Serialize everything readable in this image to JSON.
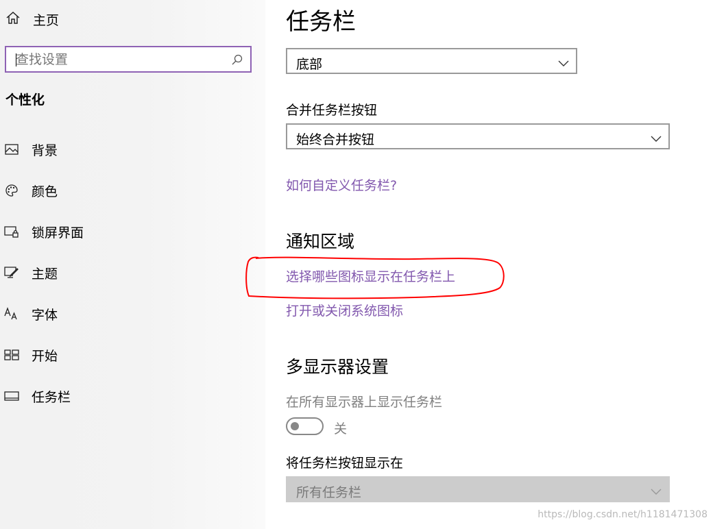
{
  "sidebar": {
    "home": {
      "label": "主页",
      "icon": "home-icon"
    },
    "search": {
      "placeholder": "查找设置",
      "icon": "search-icon"
    },
    "section_title": "个性化",
    "items": [
      {
        "label": "背景",
        "icon": "image-icon"
      },
      {
        "label": "颜色",
        "icon": "palette-icon"
      },
      {
        "label": "锁屏界面",
        "icon": "lockscreen-icon"
      },
      {
        "label": "主题",
        "icon": "theme-icon"
      },
      {
        "label": "字体",
        "icon": "font-icon"
      },
      {
        "label": "开始",
        "icon": "start-icon"
      },
      {
        "label": "任务栏",
        "icon": "taskbar-icon"
      }
    ]
  },
  "main": {
    "title": "任务栏",
    "position_dropdown": {
      "value": "底部"
    },
    "combine_label": "合并任务栏按钮",
    "combine_dropdown": {
      "value": "始终合并按钮"
    },
    "customize_link": "如何自定义任务栏?",
    "notification_heading": "通知区域",
    "select_icons_link": "选择哪些图标显示在任务栏上",
    "system_icons_link": "打开或关闭系统图标",
    "multi_display_heading": "多显示器设置",
    "show_all_label": "在所有显示器上显示任务栏",
    "show_all_toggle": {
      "state_label": "关",
      "on": false
    },
    "buttons_on_label": "将任务栏按钮显示在",
    "buttons_on_dropdown": {
      "value": "所有任务栏",
      "disabled": true
    }
  },
  "watermark": "https://blog.csdn.net/h1181471308",
  "colors": {
    "accent": "#8e62b4",
    "link": "#8258ae",
    "annotation": "#ff0000"
  }
}
